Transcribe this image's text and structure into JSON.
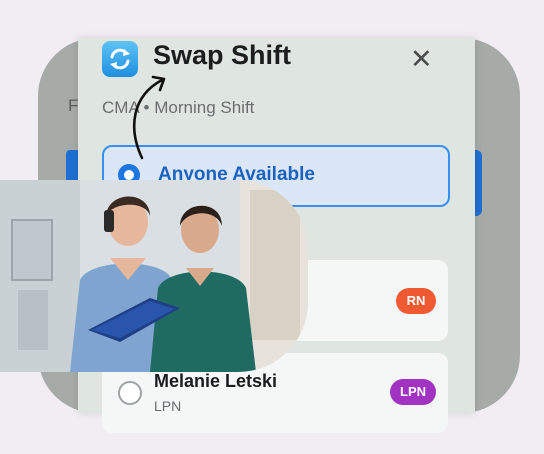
{
  "dialog": {
    "title": "Swap Shift",
    "subtitle": "CMA • Morning Shift",
    "icon": "swap-refresh-icon",
    "close_icon": "close-icon"
  },
  "options": {
    "anyone_label": "Anyone Available"
  },
  "staff": [
    {
      "name": "",
      "role": "",
      "badge": "RN",
      "badge_color": "#ef5a32"
    },
    {
      "name": "Melanie Letski",
      "role": "LPN",
      "badge": "LPN",
      "badge_color": "#a233c2"
    }
  ],
  "background": {
    "partial_letter": "F"
  },
  "colors": {
    "accent": "#1e76e1",
    "selected_border": "#3b8ff0",
    "page_bg": "#f1edf3"
  },
  "photo": {
    "description_icon": "nurses-photo"
  }
}
